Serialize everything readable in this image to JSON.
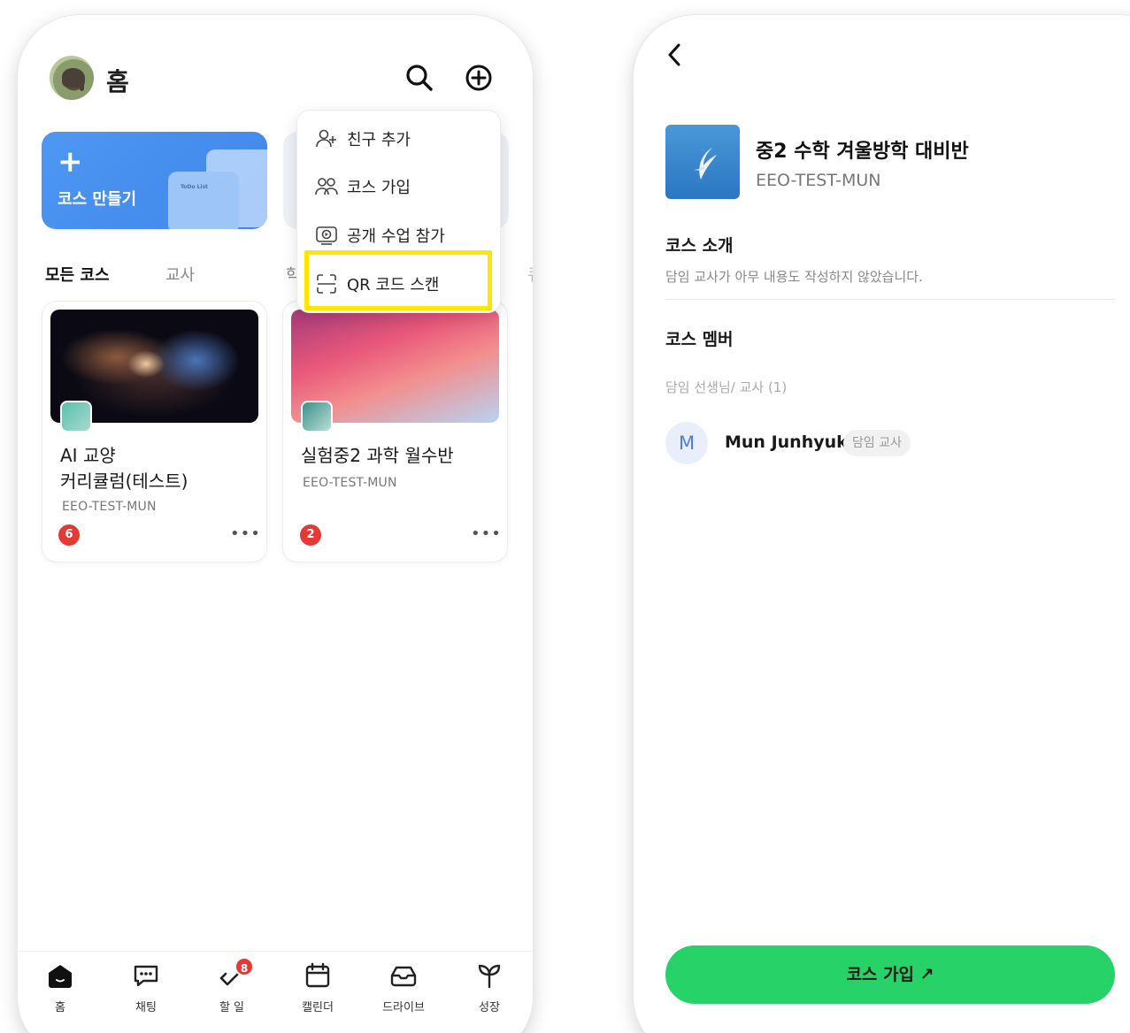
{
  "left": {
    "header": {
      "title": "홈"
    },
    "create_card": {
      "label": "코스 만들기",
      "todo": "ToDo List"
    },
    "tabs": [
      {
        "label": "모든 코스"
      },
      {
        "label": "교사"
      },
      {
        "label": "학"
      },
      {
        "label": "큐"
      }
    ],
    "courses": [
      {
        "name": "AI 교양\n커리큘럼(테스트)",
        "org": "EEO-TEST-MUN",
        "count": "6"
      },
      {
        "name": "실험중2 과학 월수반",
        "org": "EEO-TEST-MUN",
        "count": "2"
      }
    ],
    "menu": [
      {
        "label": "친구 추가",
        "icon": "add-friend-icon"
      },
      {
        "label": "코스 가입",
        "icon": "join-course-icon"
      },
      {
        "label": "공개 수업 참가",
        "icon": "live-class-icon"
      },
      {
        "label": "QR 코드 스캔",
        "icon": "qr-scan-icon"
      }
    ],
    "bottom_nav": [
      {
        "label": "홈",
        "icon": "home-icon"
      },
      {
        "label": "채팅",
        "icon": "chat-icon"
      },
      {
        "label": "할 일",
        "icon": "todo-icon",
        "badge": "8"
      },
      {
        "label": "캘린더",
        "icon": "calendar-icon"
      },
      {
        "label": "드라이브",
        "icon": "drive-icon"
      },
      {
        "label": "성장",
        "icon": "growth-icon"
      }
    ],
    "colors": {
      "accent_blue": "#4e97f2",
      "badge_red": "#e53935",
      "highlight": "#ffe600"
    }
  },
  "right": {
    "course_title": "중2 수학 겨울방학 대비반",
    "org": "EEO-TEST-MUN",
    "intro_title": "코스 소개",
    "intro_text": "담임 교사가 아무 내용도 작성하지 않았습니다.",
    "member_title": "코스 멤버",
    "teacher_label": "담임 선생님/ 교사 (1)",
    "member": {
      "initial": "M",
      "name": "Mun Junhyuk",
      "role": "담임 교사"
    },
    "join_button": "코스 가입 ↗",
    "colors": {
      "join_green": "#27d368"
    }
  }
}
